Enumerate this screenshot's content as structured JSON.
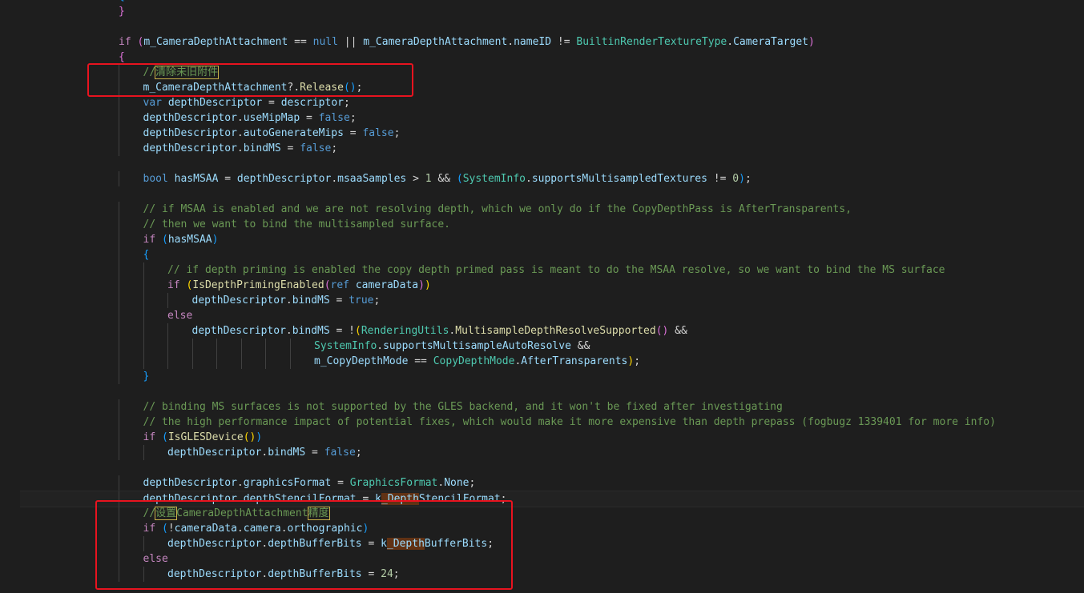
{
  "editor": {
    "lines": [
      [
        {
          "t": "{",
          "c": "p2"
        }
      ],
      [
        {
          "t": "}",
          "c": "p1"
        }
      ],
      [],
      [
        {
          "t": "if ",
          "c": "ctl"
        },
        {
          "t": "(",
          "c": "p1"
        },
        {
          "t": "m_CameraDepthAttachment",
          "c": "var"
        },
        {
          "t": " == ",
          "c": "op"
        },
        {
          "t": "null",
          "c": "kw"
        },
        {
          "t": " || ",
          "c": "op"
        },
        {
          "t": "m_CameraDepthAttachment",
          "c": "var"
        },
        {
          "t": ".",
          "c": "op"
        },
        {
          "t": "nameID",
          "c": "var"
        },
        {
          "t": " != ",
          "c": "op"
        },
        {
          "t": "BuiltinRenderTextureType",
          "c": "ty"
        },
        {
          "t": ".",
          "c": "op"
        },
        {
          "t": "CameraTarget",
          "c": "var"
        },
        {
          "t": ")",
          "c": "p1"
        }
      ],
      [
        {
          "t": "{",
          "c": "p1"
        }
      ],
      [
        {
          "t": "//",
          "c": "cm"
        },
        {
          "t": "清除未旧附件",
          "c": "cm cjk"
        }
      ],
      [
        {
          "t": "m_CameraDepthAttachment",
          "c": "var"
        },
        {
          "t": "?.",
          "c": "op"
        },
        {
          "t": "Release",
          "c": "fn"
        },
        {
          "t": "()",
          "c": "p2"
        },
        {
          "t": ";",
          "c": "op"
        }
      ],
      [
        {
          "t": "var ",
          "c": "kw"
        },
        {
          "t": "depthDescriptor",
          "c": "var"
        },
        {
          "t": " = ",
          "c": "op"
        },
        {
          "t": "descriptor",
          "c": "var"
        },
        {
          "t": ";",
          "c": "op"
        }
      ],
      [
        {
          "t": "depthDescriptor",
          "c": "var"
        },
        {
          "t": ".",
          "c": "op"
        },
        {
          "t": "useMipMap",
          "c": "var"
        },
        {
          "t": " = ",
          "c": "op"
        },
        {
          "t": "false",
          "c": "kw"
        },
        {
          "t": ";",
          "c": "op"
        }
      ],
      [
        {
          "t": "depthDescriptor",
          "c": "var"
        },
        {
          "t": ".",
          "c": "op"
        },
        {
          "t": "autoGenerateMips",
          "c": "var"
        },
        {
          "t": " = ",
          "c": "op"
        },
        {
          "t": "false",
          "c": "kw"
        },
        {
          "t": ";",
          "c": "op"
        }
      ],
      [
        {
          "t": "depthDescriptor",
          "c": "var"
        },
        {
          "t": ".",
          "c": "op"
        },
        {
          "t": "bindMS",
          "c": "var"
        },
        {
          "t": " = ",
          "c": "op"
        },
        {
          "t": "false",
          "c": "kw"
        },
        {
          "t": ";",
          "c": "op"
        }
      ],
      [],
      [
        {
          "t": "bool ",
          "c": "kw"
        },
        {
          "t": "hasMSAA",
          "c": "var"
        },
        {
          "t": " = ",
          "c": "op"
        },
        {
          "t": "depthDescriptor",
          "c": "var"
        },
        {
          "t": ".",
          "c": "op"
        },
        {
          "t": "msaaSamples",
          "c": "var"
        },
        {
          "t": " > ",
          "c": "op"
        },
        {
          "t": "1",
          "c": "num"
        },
        {
          "t": " && ",
          "c": "op"
        },
        {
          "t": "(",
          "c": "p2"
        },
        {
          "t": "SystemInfo",
          "c": "ty"
        },
        {
          "t": ".",
          "c": "op"
        },
        {
          "t": "supportsMultisampledTextures",
          "c": "var"
        },
        {
          "t": " != ",
          "c": "op"
        },
        {
          "t": "0",
          "c": "num"
        },
        {
          "t": ")",
          "c": "p2"
        },
        {
          "t": ";",
          "c": "op"
        }
      ],
      [],
      [
        {
          "t": "// if MSAA is enabled and we are not resolving depth, which we only do if the CopyDepthPass is AfterTransparents,",
          "c": "cm"
        }
      ],
      [
        {
          "t": "// then we want to bind the multisampled surface.",
          "c": "cm"
        }
      ],
      [
        {
          "t": "if ",
          "c": "ctl"
        },
        {
          "t": "(",
          "c": "p2"
        },
        {
          "t": "hasMSAA",
          "c": "var"
        },
        {
          "t": ")",
          "c": "p2"
        }
      ],
      [
        {
          "t": "{",
          "c": "p2"
        }
      ],
      [
        {
          "t": "// if depth priming is enabled the copy depth primed pass is meant to do the MSAA resolve, so we want to bind the MS surface",
          "c": "cm"
        }
      ],
      [
        {
          "t": "if ",
          "c": "ctl"
        },
        {
          "t": "(",
          "c": "p3"
        },
        {
          "t": "IsDepthPrimingEnabled",
          "c": "fn"
        },
        {
          "t": "(",
          "c": "p1"
        },
        {
          "t": "ref ",
          "c": "kw"
        },
        {
          "t": "cameraData",
          "c": "var"
        },
        {
          "t": ")",
          "c": "p1"
        },
        {
          "t": ")",
          "c": "p3"
        }
      ],
      [
        {
          "t": "depthDescriptor",
          "c": "var"
        },
        {
          "t": ".",
          "c": "op"
        },
        {
          "t": "bindMS",
          "c": "var"
        },
        {
          "t": " = ",
          "c": "op"
        },
        {
          "t": "true",
          "c": "kw"
        },
        {
          "t": ";",
          "c": "op"
        }
      ],
      [
        {
          "t": "else",
          "c": "ctl"
        }
      ],
      [
        {
          "t": "depthDescriptor",
          "c": "var"
        },
        {
          "t": ".",
          "c": "op"
        },
        {
          "t": "bindMS",
          "c": "var"
        },
        {
          "t": " = !",
          "c": "op"
        },
        {
          "t": "(",
          "c": "p3"
        },
        {
          "t": "RenderingUtils",
          "c": "ty"
        },
        {
          "t": ".",
          "c": "op"
        },
        {
          "t": "MultisampleDepthResolveSupported",
          "c": "fn"
        },
        {
          "t": "()",
          "c": "p1"
        },
        {
          "t": " &&",
          "c": "op"
        }
      ],
      [
        {
          "t": "SystemInfo",
          "c": "ty"
        },
        {
          "t": ".",
          "c": "op"
        },
        {
          "t": "supportsMultisampleAutoResolve",
          "c": "var"
        },
        {
          "t": " &&",
          "c": "op"
        }
      ],
      [
        {
          "t": "m_CopyDepthMode",
          "c": "var"
        },
        {
          "t": " == ",
          "c": "op"
        },
        {
          "t": "CopyDepthMode",
          "c": "ty"
        },
        {
          "t": ".",
          "c": "op"
        },
        {
          "t": "AfterTransparents",
          "c": "var"
        },
        {
          "t": ")",
          "c": "p3"
        },
        {
          "t": ";",
          "c": "op"
        }
      ],
      [
        {
          "t": "}",
          "c": "p2"
        }
      ],
      [],
      [
        {
          "t": "// binding MS surfaces is not supported by the GLES backend, and it won't be fixed after investigating",
          "c": "cm"
        }
      ],
      [
        {
          "t": "// the high performance impact of potential fixes, which would make it more expensive than depth prepass (fogbugz 1339401 for more info)",
          "c": "cm"
        }
      ],
      [
        {
          "t": "if ",
          "c": "ctl"
        },
        {
          "t": "(",
          "c": "p2"
        },
        {
          "t": "IsGLESDevice",
          "c": "fn"
        },
        {
          "t": "()",
          "c": "p3"
        },
        {
          "t": ")",
          "c": "p2"
        }
      ],
      [
        {
          "t": "depthDescriptor",
          "c": "var"
        },
        {
          "t": ".",
          "c": "op"
        },
        {
          "t": "bindMS",
          "c": "var"
        },
        {
          "t": " = ",
          "c": "op"
        },
        {
          "t": "false",
          "c": "kw"
        },
        {
          "t": ";",
          "c": "op"
        }
      ],
      [],
      [
        {
          "t": "depthDescriptor",
          "c": "var"
        },
        {
          "t": ".",
          "c": "op"
        },
        {
          "t": "graphicsFormat",
          "c": "var"
        },
        {
          "t": " = ",
          "c": "op"
        },
        {
          "t": "GraphicsFormat",
          "c": "ty"
        },
        {
          "t": ".",
          "c": "op"
        },
        {
          "t": "None",
          "c": "var"
        },
        {
          "t": ";",
          "c": "op"
        }
      ],
      [
        {
          "t": "depthDescriptor",
          "c": "var"
        },
        {
          "t": ".",
          "c": "op"
        },
        {
          "t": "depthStencilFormat",
          "c": "var"
        },
        {
          "t": " = ",
          "c": "op"
        },
        {
          "t": "k",
          "c": "var"
        },
        {
          "t": "_Depth",
          "c": "var hl"
        },
        {
          "t": "StencilFormat",
          "c": "var"
        },
        {
          "t": ";",
          "c": "op"
        }
      ],
      [
        {
          "t": "//",
          "c": "cm"
        },
        {
          "t": "设置",
          "c": "cm cjk"
        },
        {
          "t": "CameraDepthAttachment",
          "c": "cm"
        },
        {
          "t": "精度",
          "c": "cm cjk"
        }
      ],
      [
        {
          "t": "if ",
          "c": "ctl"
        },
        {
          "t": "(",
          "c": "p2"
        },
        {
          "t": "!",
          "c": "op"
        },
        {
          "t": "cameraData",
          "c": "var"
        },
        {
          "t": ".",
          "c": "op"
        },
        {
          "t": "camera",
          "c": "var"
        },
        {
          "t": ".",
          "c": "op"
        },
        {
          "t": "orthographic",
          "c": "var"
        },
        {
          "t": ")",
          "c": "p2"
        }
      ],
      [
        {
          "t": "depthDescriptor",
          "c": "var"
        },
        {
          "t": ".",
          "c": "op"
        },
        {
          "t": "depthBufferBits",
          "c": "var"
        },
        {
          "t": " = ",
          "c": "op"
        },
        {
          "t": "k",
          "c": "var"
        },
        {
          "t": "_Depth",
          "c": "var hl"
        },
        {
          "t": "BufferBits",
          "c": "var"
        },
        {
          "t": ";",
          "c": "op"
        }
      ],
      [
        {
          "t": "else",
          "c": "ctl"
        }
      ],
      [
        {
          "t": "depthDescriptor",
          "c": "var"
        },
        {
          "t": ".",
          "c": "op"
        },
        {
          "t": "depthBufferBits",
          "c": "var"
        },
        {
          "t": " = ",
          "c": "op"
        },
        {
          "t": "24",
          "c": "num"
        },
        {
          "t": ";",
          "c": "op"
        }
      ]
    ]
  },
  "annotations": {
    "color": "#e8131f"
  }
}
